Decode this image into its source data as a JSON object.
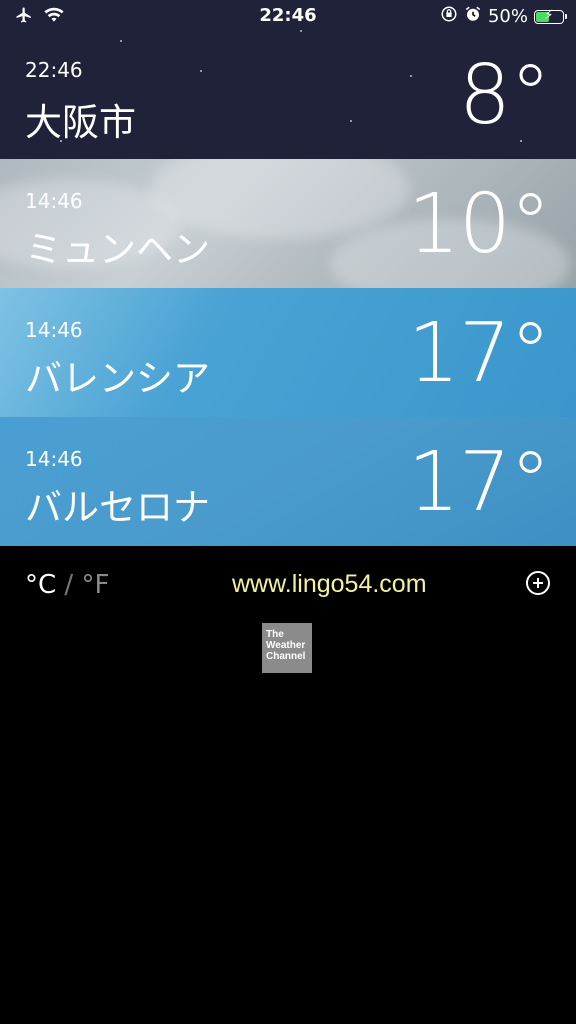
{
  "status_bar": {
    "time": "22:46",
    "battery_percent": "50%",
    "battery_level": 0.5,
    "icons": [
      "airplane-icon",
      "wifi-icon",
      "orientation-lock-icon",
      "alarm-icon",
      "battery-icon"
    ]
  },
  "cities": [
    {
      "time": "22:46",
      "name": "大阪市",
      "temp": "8°"
    },
    {
      "time": "14:46",
      "name": "ミュンヘン",
      "temp": "10°"
    },
    {
      "time": "14:46",
      "name": "バレンシア",
      "temp": "17°"
    },
    {
      "time": "14:46",
      "name": "バルセロナ",
      "temp": "17°"
    }
  ],
  "footer": {
    "unit_c": "°C",
    "unit_sep": " / ",
    "unit_f": "°F",
    "watermark": "www.lingo54.com",
    "add_icon": "plus-circle-icon"
  },
  "logo": {
    "line1": "The",
    "line2": "Weather",
    "line3": "Channel"
  },
  "colors": {
    "battery": "#4cd964",
    "watermark": "#f4f29a"
  }
}
